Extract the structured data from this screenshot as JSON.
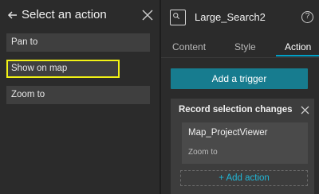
{
  "left_panel": {
    "title": "Select an action",
    "actions": [
      {
        "label": "Pan to"
      },
      {
        "label": "Show on map"
      },
      {
        "label": "Zoom to"
      }
    ]
  },
  "right_panel": {
    "widget_name": "Large_Search2",
    "help_glyph": "?",
    "tabs": [
      {
        "label": "Content"
      },
      {
        "label": "Style"
      },
      {
        "label": "Action"
      }
    ],
    "add_trigger_label": "Add a trigger",
    "trigger_card": {
      "title": "Record selection changes",
      "map_name": "Map_ProjectViewer",
      "action_name": "Zoom to",
      "add_action_label": "+ Add action"
    }
  },
  "colors": {
    "highlight": "#f2f215",
    "accent": "#177c8f",
    "tab_active_underline": "#00a0c6",
    "link": "#22b6d6"
  }
}
